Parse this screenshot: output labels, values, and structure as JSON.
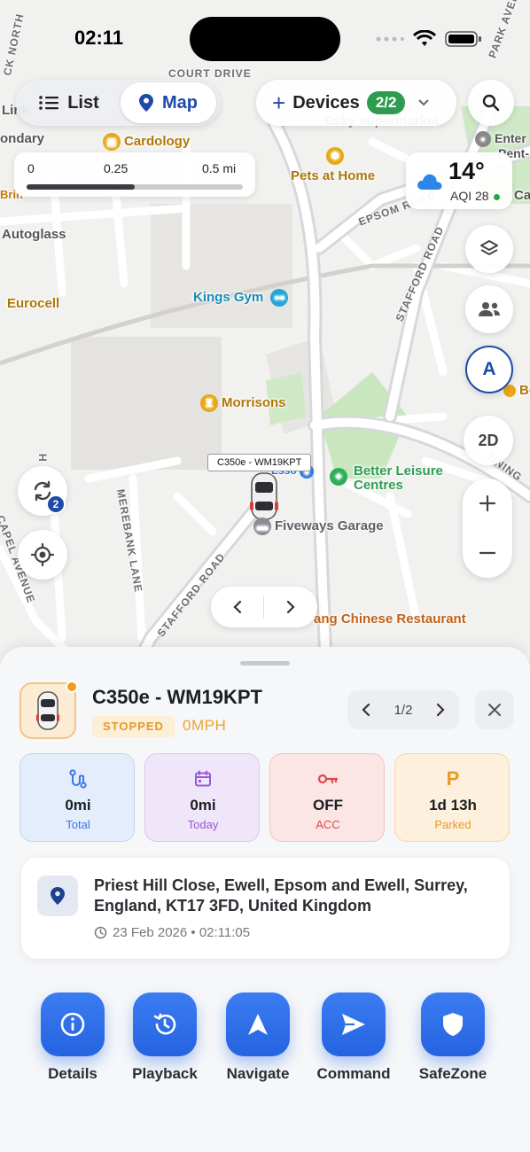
{
  "status_bar": {
    "time": "02:11"
  },
  "top_bar": {
    "list_label": "List",
    "map_label": "Map",
    "devices_label": "Devices",
    "devices_badge": "2/2"
  },
  "scale": {
    "tick_0": "0",
    "tick_1": "0.25",
    "tick_2": "0.5 mi",
    "fill_fraction": 0.5
  },
  "weather": {
    "temp": "14°",
    "aqi": "AQI 28"
  },
  "map_controls": {
    "view_2d": "2D",
    "compass_label": "A",
    "refresh_badge": "2"
  },
  "map": {
    "pois": {
      "link": "Link",
      "ondary": "ondary",
      "cardology": "Cardology",
      "esky": "Esky supermarket",
      "enter": "Enter",
      "pent": "Pent-",
      "pets": "Pets at Home",
      "autoglass": "Autoglass",
      "eurocell": "Eurocell",
      "kings_gym": "Kings Gym",
      "morrisons": "Morrisons",
      "bo": "Bo",
      "ca": "Ca",
      "esso": "Esso",
      "better_leisure": "Better Leisure Centres",
      "fiveways": "Fiveways Garage",
      "chinese": "Chinese Restaurant",
      "chinese_prefix": "ang",
      "brin": "Brin"
    },
    "streets": {
      "court_drive": "COURT DRIVE",
      "epsom_road": "EPSOM ROAD",
      "stafford_road": "STAFFORD ROAD",
      "stafford_road_2": "STAFFORD ROAD",
      "merebank_lane": "MEREBANK LANE",
      "capel_avenue": "CAPEL AVENUE",
      "park_avenue": "PARK AVENUE",
      "nning": "NNING",
      "ck_north": "CK NORTH",
      "h_label": "H"
    },
    "car_label": "C350e - WM19KPT"
  },
  "sheet": {
    "vehicle_name": "C350e - WM19KPT",
    "status": "STOPPED",
    "speed": "0MPH",
    "pager": "1/2",
    "stats": [
      {
        "value": "0mi",
        "label": "Total",
        "icon": "route-icon",
        "color": "#3a78e6"
      },
      {
        "value": "0mi",
        "label": "Today",
        "icon": "calendar-icon",
        "color": "#9a58d6"
      },
      {
        "value": "OFF",
        "label": "ACC",
        "icon": "key-icon",
        "color": "#e04848"
      },
      {
        "value": "1d 13h",
        "label": "Parked",
        "icon": "parking-icon",
        "color": "#e99a21"
      }
    ],
    "address": "Priest Hill Close, Ewell, Epsom and Ewell, Surrey, England, KT17 3FD, United Kingdom",
    "timestamp": "23 Feb 2026 • 02:11:05",
    "actions": [
      {
        "label": "Details",
        "icon": "info-icon"
      },
      {
        "label": "Playback",
        "icon": "history-icon"
      },
      {
        "label": "Navigate",
        "icon": "navigate-arrow-icon"
      },
      {
        "label": "Command",
        "icon": "send-icon"
      },
      {
        "label": "SafeZone",
        "icon": "shield-icon"
      }
    ]
  },
  "colors": {
    "accent": "#1f4aa8",
    "action_blue": "#2f6ee8",
    "status_orange": "#f29d1a",
    "green": "#2e9c4e"
  }
}
